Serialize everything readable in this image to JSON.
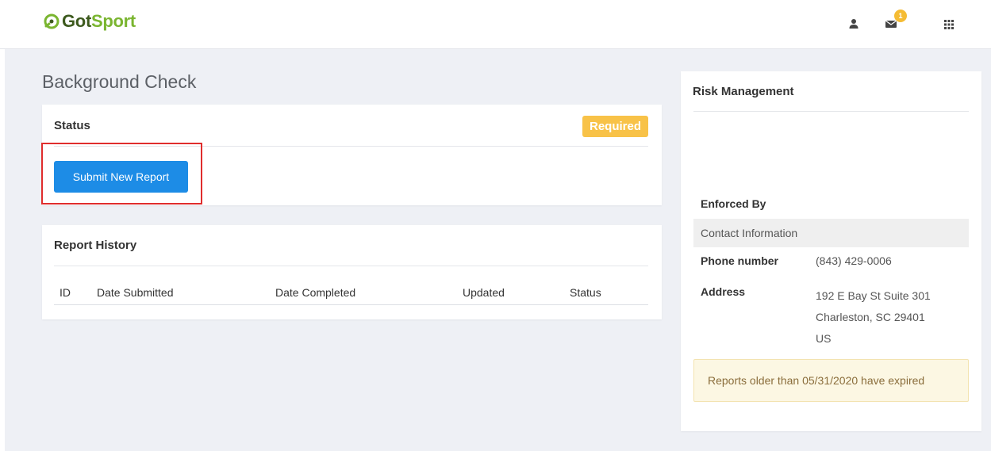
{
  "brand": {
    "got": "Got",
    "sport": "Sport",
    "accent": "#7ab530"
  },
  "topbar": {
    "icons": [
      "user-icon",
      "mail-icon",
      "grid-icon"
    ],
    "mail_count": "1"
  },
  "page": {
    "title": "Background Check"
  },
  "status_card": {
    "title": "Status",
    "badge": "Required",
    "badge_color": "#f8c248",
    "submit_label": "Submit New Report",
    "button_color": "#1d8ce6",
    "highlight_color": "#e02d2d"
  },
  "history_card": {
    "title": "Report History",
    "columns": [
      "ID",
      "Date Submitted",
      "Date Completed",
      "Updated",
      "Status"
    ]
  },
  "risk_card": {
    "title": "Risk Management",
    "enforced_by_label": "Enforced By",
    "contact_heading": "Contact Information",
    "phone_label": "Phone number",
    "phone_value": "(843) 429-0006",
    "address_label": "Address",
    "address_lines": [
      "192 E Bay St Suite 301",
      "Charleston, SC 29401",
      "US"
    ],
    "notice": "Reports older than 05/31/2020 have expired"
  }
}
